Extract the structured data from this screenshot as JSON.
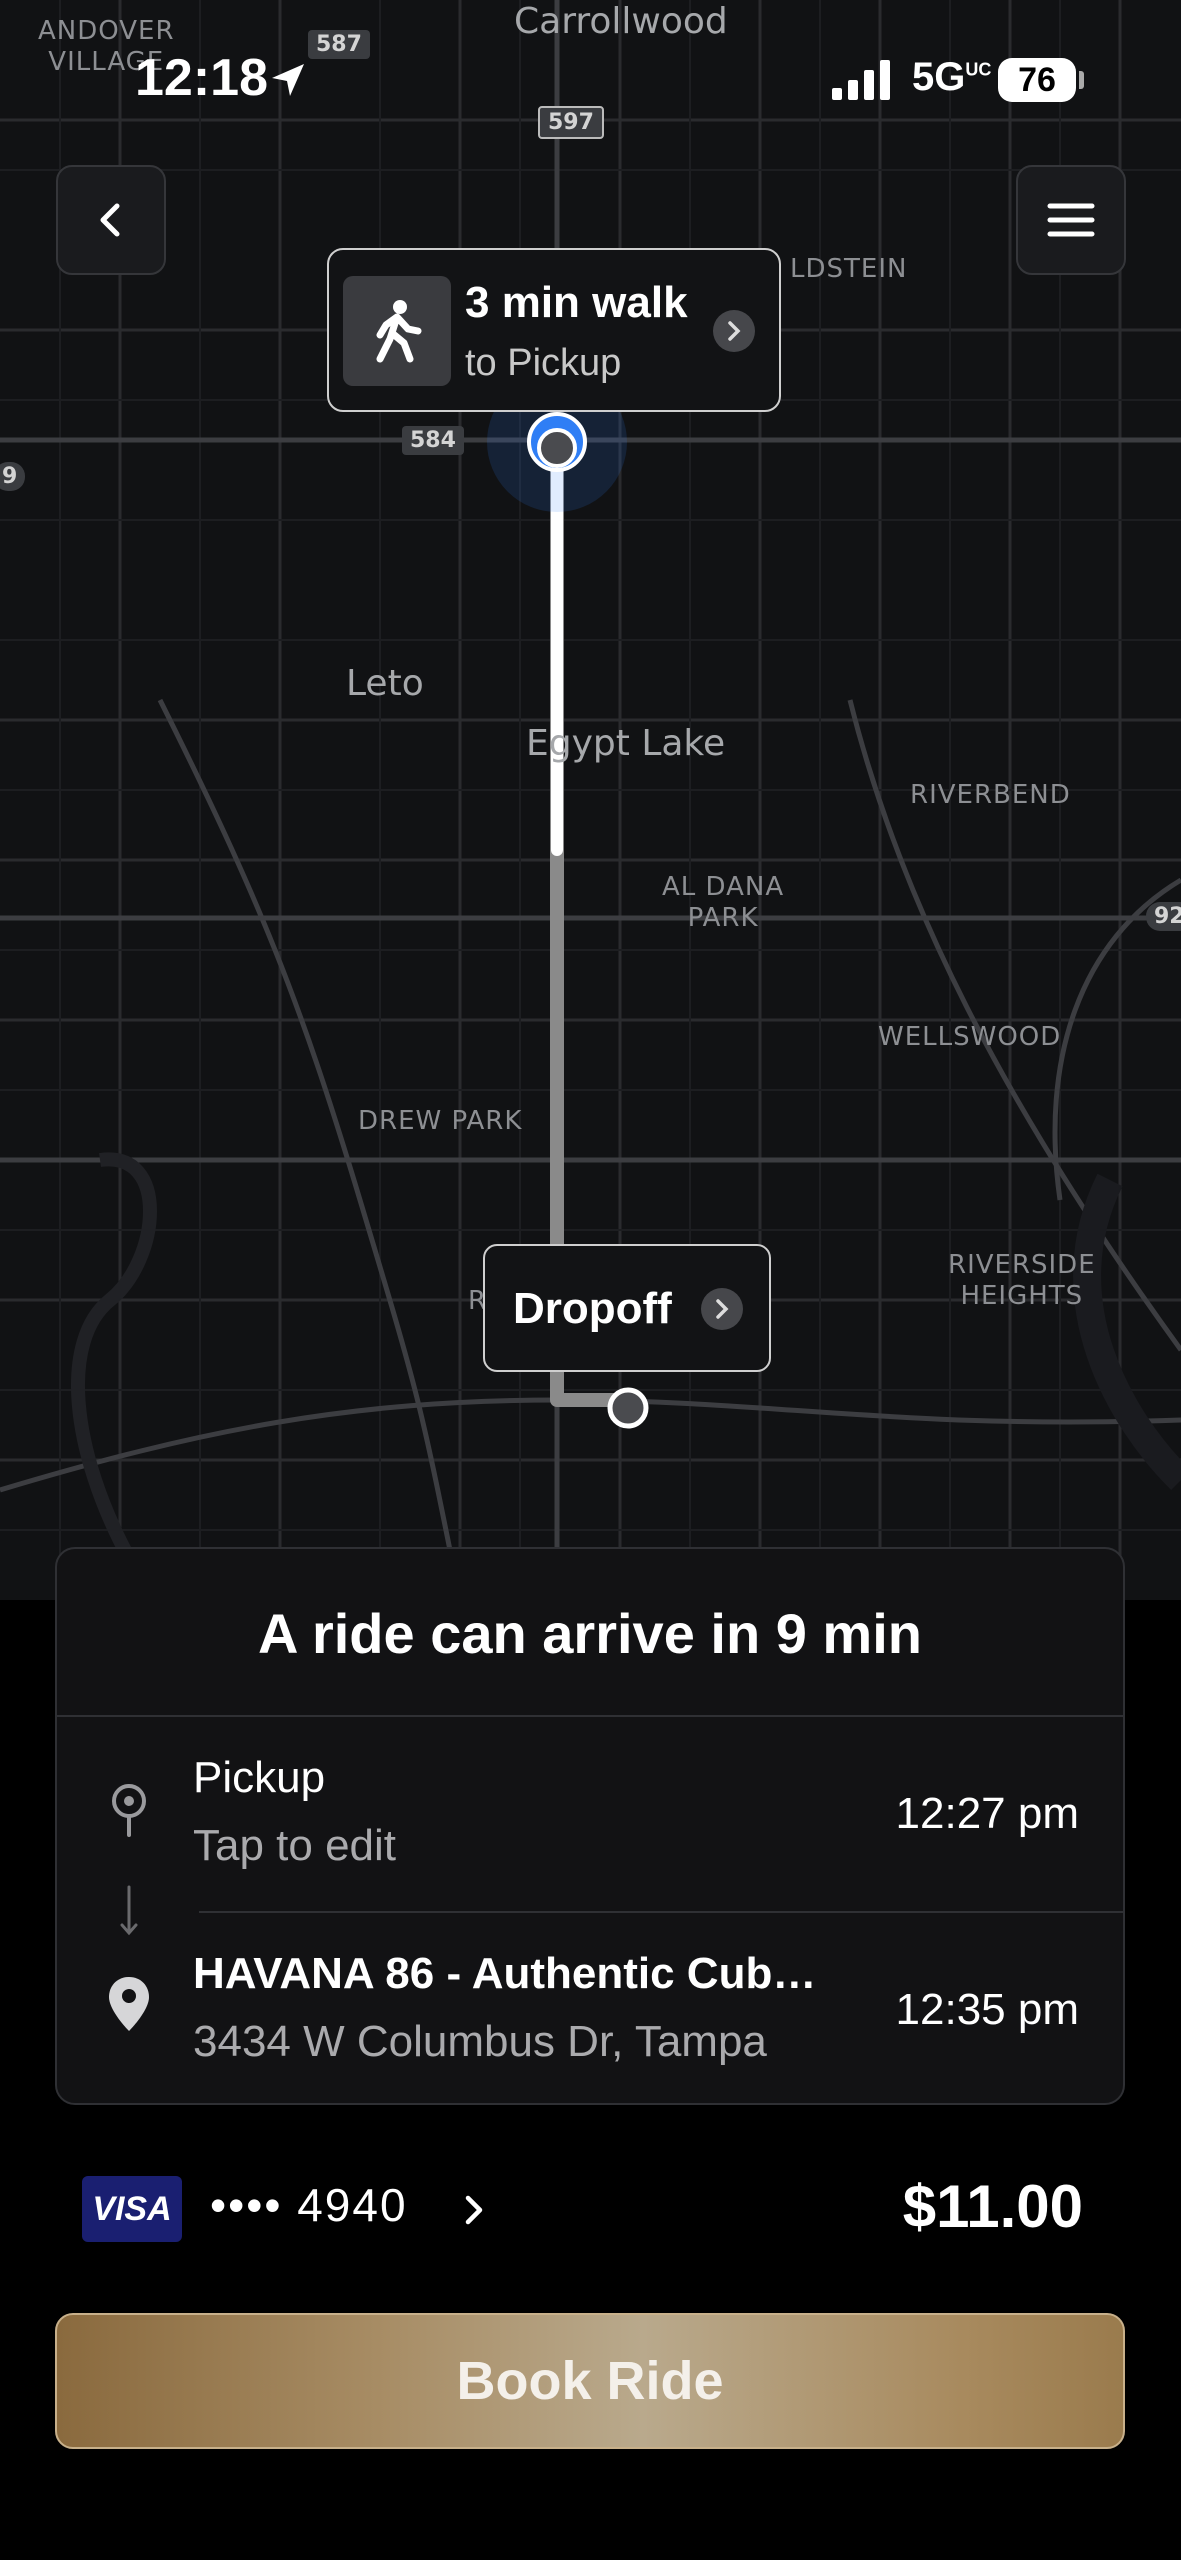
{
  "status_bar": {
    "time": "12:18",
    "network": "5G",
    "network_suffix": "UC",
    "battery": "76"
  },
  "map": {
    "labels": {
      "andover_village": "ANDOVER\nVILLAGE",
      "carrollwood": "Carrollwood",
      "goldstein": "LDSTEIN",
      "leto": "Leto",
      "egypt_lake": "Egypt Lake",
      "riverbend": "RIVERBEND",
      "al_dana_park": "AL DANA\nPARK",
      "wellswood": "WELLSWOOD",
      "drew_park": "DREW PARK",
      "riverside_heights": "RIVERSIDE\nHEIGHTS",
      "r_partial": "R"
    },
    "shields": {
      "s587": "587",
      "s597": "597",
      "s584": "584",
      "s92": "92",
      "s9": "9"
    }
  },
  "walk_card": {
    "title": "3 min walk",
    "subtitle": "to Pickup"
  },
  "dropoff_card": {
    "label": "Dropoff"
  },
  "ride_panel": {
    "eta": "A ride can arrive in 9 min",
    "pickup": {
      "label": "Pickup",
      "sub": "Tap to edit",
      "time": "12:27 pm"
    },
    "destination": {
      "label": "HAVANA 86 - Authentic Cub…",
      "sub": "3434 W Columbus Dr, Tampa",
      "time": "12:35 pm"
    }
  },
  "payment": {
    "brand": "VISA",
    "card": "•••• 4940",
    "price": "$11.00"
  },
  "book_button": {
    "label": "Book Ride"
  },
  "colors": {
    "accent_gold": "#a78c64",
    "route_white": "#ffffff",
    "pickup_blue": "#2f7ef5",
    "visa_blue": "#1a1f71"
  },
  "icons": {
    "back": "chevron-left-icon",
    "menu": "hamburger-menu-icon",
    "walk": "walking-person-icon",
    "pickup": "pin-outline-icon",
    "destination": "pin-filled-icon"
  }
}
